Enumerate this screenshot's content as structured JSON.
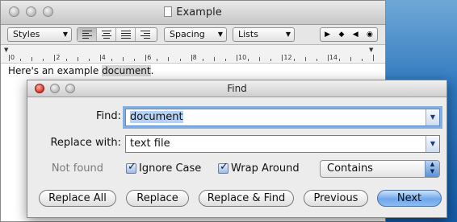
{
  "editor": {
    "title": "Example",
    "toolbar": {
      "styles_label": "Styles",
      "spacing_label": "Spacing",
      "lists_label": "Lists"
    },
    "ruler_numbers": [
      "0",
      "2",
      "4",
      "6",
      "8",
      "10",
      "12",
      "14"
    ],
    "body_text_before": "Here's an example ",
    "body_text_highlight": "document",
    "body_text_after": "."
  },
  "find_panel": {
    "title": "Find",
    "find_label": "Find:",
    "find_value": "document",
    "replace_label": "Replace with:",
    "replace_value": "text file",
    "status_text": "Not found",
    "ignore_case_label": "Ignore Case",
    "ignore_case_checked": true,
    "wrap_around_label": "Wrap Around",
    "wrap_around_checked": true,
    "match_mode": "Contains",
    "buttons": {
      "replace_all": "Replace All",
      "replace": "Replace",
      "replace_and_find": "Replace & Find",
      "previous": "Previous",
      "next": "Next"
    },
    "colors": {
      "close_red": "#e0413a",
      "default_button_blue": "#6fa7ea",
      "focus_ring": "#84aee0",
      "selection": "#b5d1f5"
    }
  }
}
